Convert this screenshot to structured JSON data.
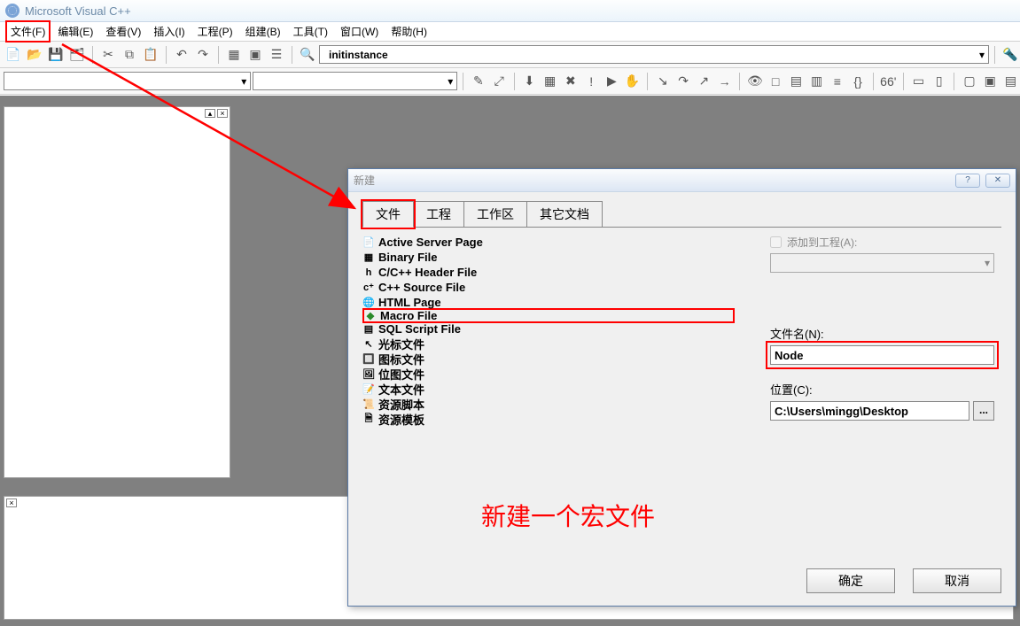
{
  "app": {
    "title": "Microsoft Visual C++"
  },
  "menu": {
    "file": "文件(F)",
    "edit": "编辑(E)",
    "view": "查看(V)",
    "insert": "插入(I)",
    "project": "工程(P)",
    "build": "组建(B)",
    "tools": "工具(T)",
    "window": "窗口(W)",
    "help": "帮助(H)"
  },
  "toolbar": {
    "combo_value": "initinstance"
  },
  "dialog": {
    "title": "新建",
    "tabs": {
      "file": "文件",
      "project": "工程",
      "workspace": "工作区",
      "other": "其它文档"
    },
    "files": {
      "asp": "Active Server Page",
      "binary": "Binary File",
      "header": "C/C++ Header File",
      "source": "C++ Source File",
      "html": "HTML Page",
      "macro": "Macro File",
      "sql": "SQL Script File",
      "cursor": "光标文件",
      "icon": "图标文件",
      "bitmap": "位图文件",
      "text": "文本文件",
      "script": "资源脚本",
      "template": "资源模板"
    },
    "add_to_project": "添加到工程(A):",
    "filename_label": "文件名(N):",
    "filename_value": "Node",
    "location_label": "位置(C):",
    "location_value": "C:\\Users\\mingg\\Desktop",
    "ok": "确定",
    "cancel": "取消"
  },
  "annotation": "新建一个宏文件"
}
